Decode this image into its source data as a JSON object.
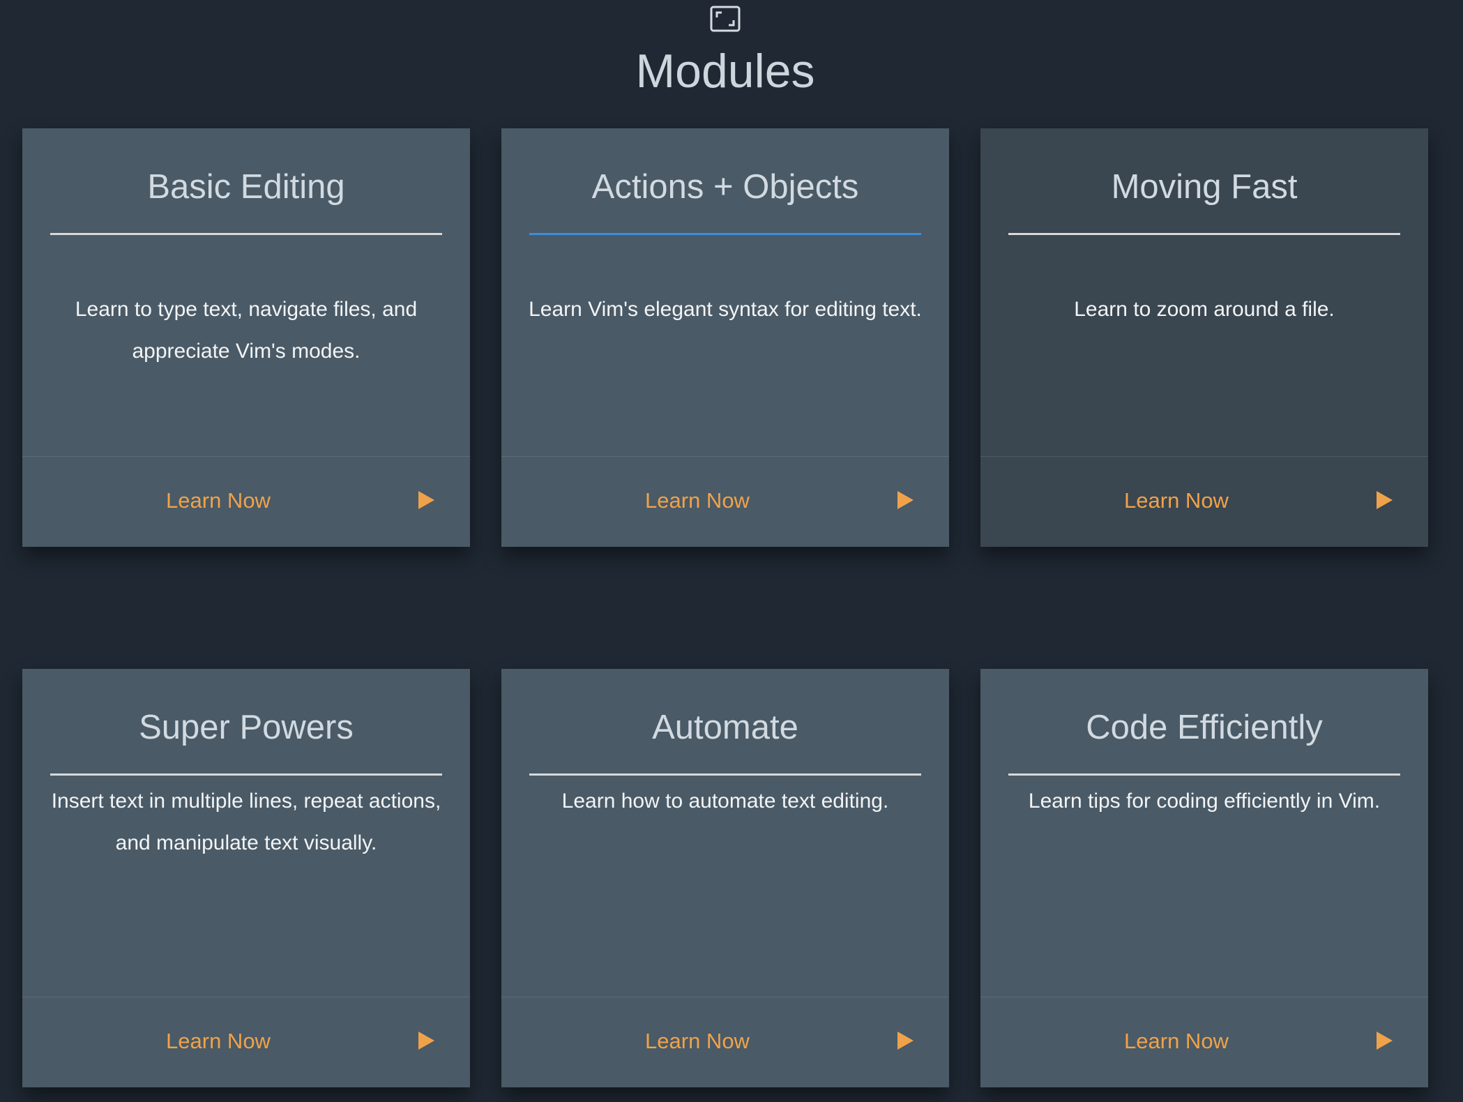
{
  "page": {
    "title": "Modules",
    "icon": "expand-icon"
  },
  "colors": {
    "background": "#1f2833",
    "card": "#4a5a66",
    "card_dim": "#3a4650",
    "accent": "#f0a24a",
    "active_rule": "#3a8fd8"
  },
  "modules": [
    {
      "title": "Basic Editing",
      "description": "Learn to type text, navigate files, and appreciate Vim's modes.",
      "link": "Learn Now",
      "icon": "play-icon"
    },
    {
      "title": "Actions + Objects",
      "description": "Learn Vim's elegant syntax for editing text.",
      "link": "Learn Now",
      "icon": "play-icon"
    },
    {
      "title": "Moving Fast",
      "description": "Learn to zoom around a file.",
      "link": "Learn Now",
      "icon": "play-icon"
    },
    {
      "title": "Super Powers",
      "description": "Insert text in multiple lines, repeat actions, and manipulate text visually.",
      "link": "Learn Now",
      "icon": "play-icon"
    },
    {
      "title": "Automate",
      "description": "Learn how to automate text editing.",
      "link": "Learn Now",
      "icon": "play-icon"
    },
    {
      "title": "Code Efficiently",
      "description": "Learn tips for coding efficiently in Vim.",
      "link": "Learn Now",
      "icon": "play-icon"
    }
  ]
}
